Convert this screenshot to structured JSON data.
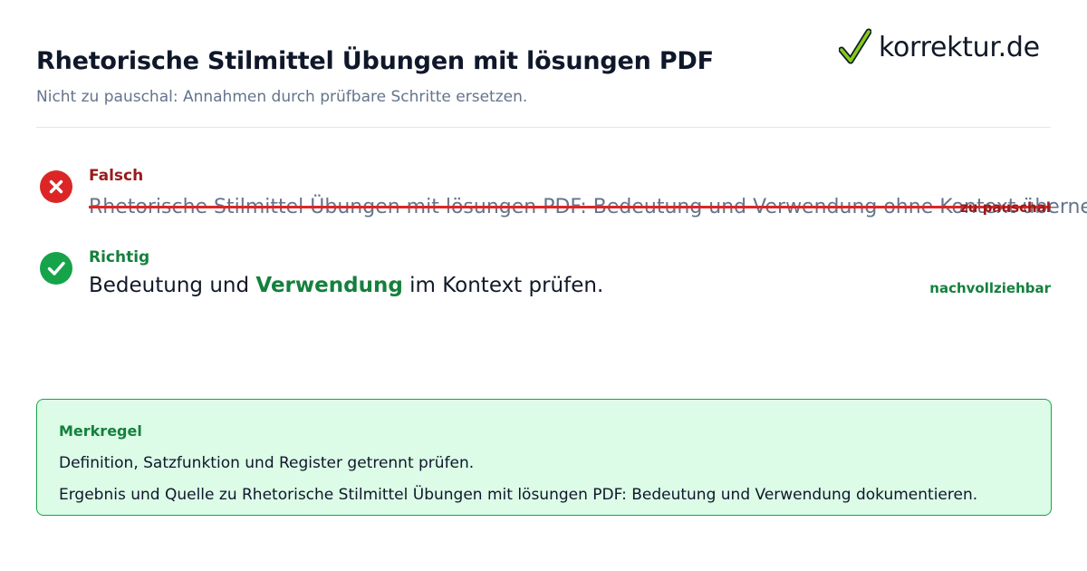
{
  "header": {
    "title": "Rhetorische Stilmittel Übungen mit lösungen PDF",
    "subtitle": "Nicht zu pauschal: Annahmen durch prüfbare Schritte ersetzen."
  },
  "logo": {
    "text": "korrektur.de",
    "icon": "checkmark-icon"
  },
  "wrong": {
    "label": "Falsch",
    "text": "Rhetorische Stilmittel Übungen mit lösungen PDF: Bedeutung und Verwendung ohne Kontext übernehmen.",
    "tag": "zu pauschal",
    "icon": "x-circle-icon",
    "color": "#dc2626"
  },
  "right": {
    "label": "Richtig",
    "text_before": "Bedeutung und ",
    "keyword": "Verwendung",
    "text_after": " im Kontext prüfen.",
    "tag": "nachvollziehbar",
    "icon": "check-circle-icon",
    "color": "#16a34a"
  },
  "rule": {
    "title": "Merkregel",
    "lines": [
      "Definition, Satzfunktion und Register getrennt prüfen.",
      "Ergebnis und Quelle zu Rhetorische Stilmittel Übungen mit lösungen PDF: Bedeutung und Verwendung dokumentieren."
    ]
  }
}
